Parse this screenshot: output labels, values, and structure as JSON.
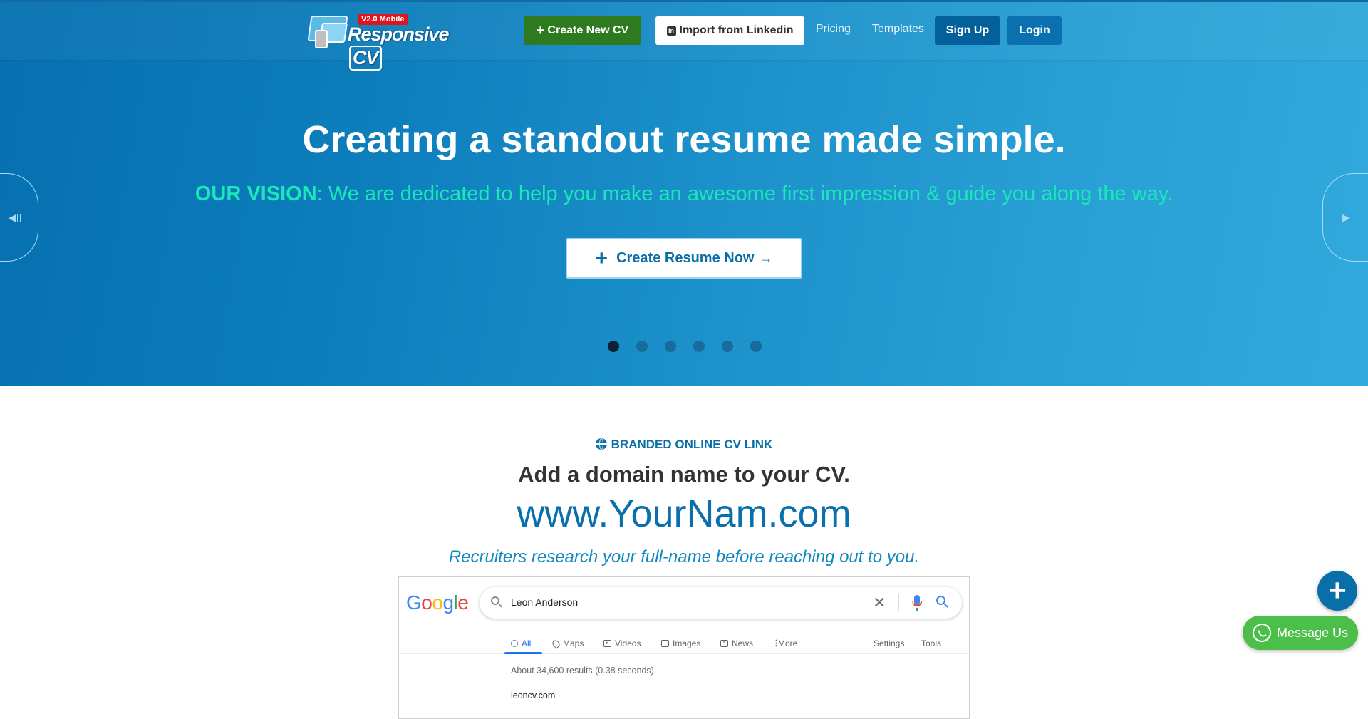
{
  "header": {
    "logo": {
      "badge": "V2.0 Mobile",
      "word": "Responsive",
      "cv": "CV"
    },
    "nav": {
      "create_new_cv": "Create New CV",
      "import_linkedin": "Import from Linkedin",
      "linkedin_icon": "in",
      "pricing": "Pricing",
      "templates": "Templates",
      "sign_up": "Sign Up",
      "login": "Login"
    }
  },
  "hero": {
    "title": "Creating a standout resume made simple.",
    "vision_label": "OUR VISION",
    "vision_text": ": We are dedicated to help you make an awesome first impression & guide you along the way.",
    "cta_label": "Create Resume Now",
    "cta_plus": "+",
    "cta_arrow": "→",
    "prev_glyph": "◀",
    "next_glyph": "▶",
    "slides_total": 6,
    "active_slide": 1
  },
  "branded_section": {
    "kicker": "BRANDED ONLINE CV LINK",
    "subtitle": "Add a domain name to your CV.",
    "domain": "www.YourNam.com",
    "tagline": "Recruiters research your full-name before reaching out to you."
  },
  "google_mock": {
    "logo_letters": [
      "G",
      "o",
      "o",
      "g",
      "l",
      "e"
    ],
    "query": "Leon Anderson",
    "clear_glyph": "✕",
    "tabs": [
      {
        "label": "All",
        "icon": "search-icon",
        "active": true
      },
      {
        "label": "Maps",
        "icon": "map-pin-icon"
      },
      {
        "label": "Videos",
        "icon": "video-icon"
      },
      {
        "label": "Images",
        "icon": "image-icon"
      },
      {
        "label": "News",
        "icon": "news-icon"
      },
      {
        "label": "More",
        "icon": "more-vertical-icon"
      }
    ],
    "settings": "Settings",
    "tools": "Tools",
    "stats": "About 34,600 results (0.38 seconds)",
    "first_result": "leoncv.com"
  },
  "floating": {
    "plus": "+",
    "message_label": "Message Us"
  },
  "colors": {
    "brand_blue": "#0a6fa8",
    "create_green": "#2e7a1e",
    "signup_blue": "#04609a",
    "vision_teal": "#1ae8b8",
    "whatsapp_green": "#4bbf4a"
  }
}
